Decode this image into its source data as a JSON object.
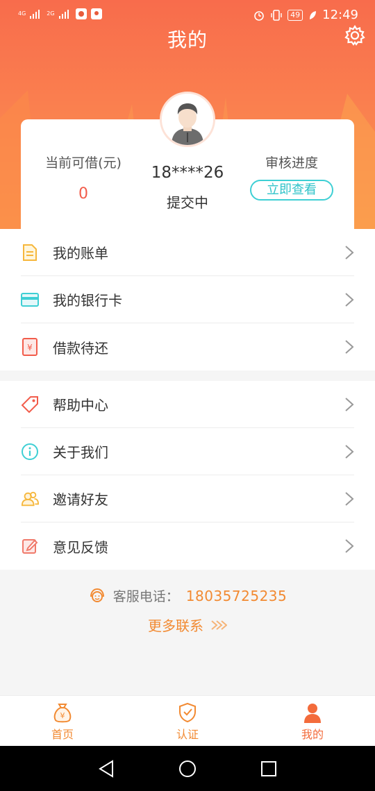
{
  "status_bar": {
    "network_left": "4G",
    "network_right": "2G",
    "battery": "49",
    "time": "12:49"
  },
  "header": {
    "title": "我的"
  },
  "profile": {
    "credit_label": "当前可借(元)",
    "credit_value": "0",
    "phone": "18****26",
    "status": "提交中",
    "review_label": "审核进度",
    "review_button": "立即查看"
  },
  "menu_group_1": [
    {
      "label": "我的账单",
      "icon": "bill-icon"
    },
    {
      "label": "我的银行卡",
      "icon": "bank-card-icon"
    },
    {
      "label": "借款待还",
      "icon": "repay-icon"
    }
  ],
  "menu_group_2": [
    {
      "label": "帮助中心",
      "icon": "tag-icon"
    },
    {
      "label": "关于我们",
      "icon": "info-icon"
    },
    {
      "label": "邀请好友",
      "icon": "friends-icon"
    },
    {
      "label": "意见反馈",
      "icon": "edit-icon"
    }
  ],
  "contact": {
    "label": "客服电话：",
    "phone": "18035725235",
    "more": "更多联系"
  },
  "tabbar": {
    "items": [
      {
        "label": "首页",
        "icon": "money-bag-icon"
      },
      {
        "label": "认证",
        "icon": "shield-check-icon"
      },
      {
        "label": "我的",
        "icon": "person-icon",
        "active": true
      }
    ]
  },
  "colors": {
    "header_top": "#f86c4c",
    "header_bottom": "#fb9a4d",
    "accent_orange": "#f28a32",
    "teal": "#3ecfd4",
    "red": "#f25c4b"
  }
}
